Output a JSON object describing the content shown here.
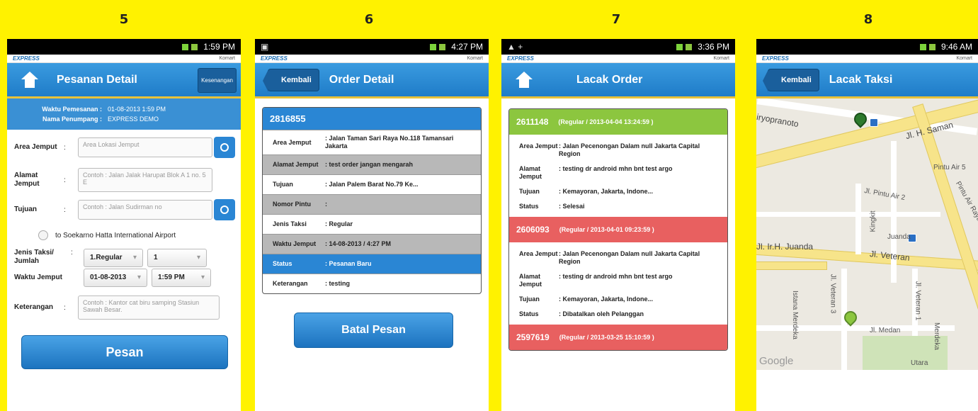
{
  "numbers": [
    "5",
    "6",
    "7",
    "8"
  ],
  "common": {
    "brand_left": "EXPRESS",
    "brand_right": "Komart"
  },
  "phone5": {
    "time": "1:59 PM",
    "header_title": "Pesanan Detail",
    "header_button": "Kesenangan",
    "info": [
      {
        "label": "Waktu Pemesanan :",
        "value": "01-08-2013 1:59 PM"
      },
      {
        "label": "Nama Penumpang :",
        "value": "EXPRESS DEMO"
      }
    ],
    "area_jemput": {
      "label": "Area Jemput",
      "placeholder": "Area Lokasi Jemput"
    },
    "alamat_jemput": {
      "label": "Alamat Jemput",
      "placeholder": "Contoh : Jalan Jalak Harupat Blok A 1 no. 5 E"
    },
    "tujuan": {
      "label": "Tujuan",
      "placeholder": "Contoh : Jalan Sudirman no"
    },
    "airport": "to Soekarno Hatta International Airport",
    "jenis": {
      "label": "Jenis Taksi/ Jumlah",
      "value": "1.Regular",
      "count": "1"
    },
    "waktu": {
      "label": "Waktu Jemput",
      "date": "01-08-2013",
      "time": "1:59 PM"
    },
    "keterangan": {
      "label": "Keterangan",
      "placeholder": "Contoh : Kantor cat biru samping Stasiun Sawah Besar."
    },
    "submit": "Pesan"
  },
  "phone6": {
    "time": "4:27 PM",
    "back": "Kembali",
    "header_title": "Order Detail",
    "order_id": "2816855",
    "rows": [
      {
        "k": "Area Jemput",
        "v": ": Jalan Taman Sari Raya No.118 Tamansari Jakarta",
        "style": "white"
      },
      {
        "k": "Alamat Jemput",
        "v": ": test order jangan mengarah",
        "style": "gray"
      },
      {
        "k": "Tujuan",
        "v": ": Jalan Palem Barat No.79 Ke...",
        "style": "white"
      },
      {
        "k": "Nomor Pintu",
        "v": ":",
        "style": "gray"
      },
      {
        "k": "Jenis Taksi",
        "v": ": Regular",
        "style": "white"
      },
      {
        "k": "Waktu Jemput",
        "v": ": 14-08-2013 / 4:27 PM",
        "style": "gray"
      },
      {
        "k": "Status",
        "v": ": Pesanan Baru",
        "style": "blue"
      },
      {
        "k": "Keterangan",
        "v": ": testing",
        "style": "white"
      }
    ],
    "cancel": "Batal Pesan"
  },
  "phone7": {
    "time": "3:36 PM",
    "header_title": "Lacak Order",
    "orders": [
      {
        "id": "2611148",
        "meta": "(Regular / 2013-04-04 13:24:59 )",
        "color": "green",
        "rows": [
          {
            "k": "Area Jemput",
            "v": ": Jalan Pecenongan Dalam null Jakarta Capital Region"
          },
          {
            "k": "Alamat Jemput",
            "v": ": testing dr android mhn bnt test argo"
          },
          {
            "k": "Tujuan",
            "v": ": Kemayoran, Jakarta, Indone..."
          },
          {
            "k": "Status",
            "v": ": Selesai"
          }
        ]
      },
      {
        "id": "2606093",
        "meta": "(Regular / 2013-04-01 09:23:59 )",
        "color": "red",
        "rows": [
          {
            "k": "Area Jemput",
            "v": ": Jalan Pecenongan Dalam null Jakarta Capital Region"
          },
          {
            "k": "Alamat Jemput",
            "v": ": testing dr android mhn bnt test argo"
          },
          {
            "k": "Tujuan",
            "v": ": Kemayoran, Jakarta, Indone..."
          },
          {
            "k": "Status",
            "v": ": Dibatalkan oleh Pelanggan"
          }
        ]
      },
      {
        "id": "2597619",
        "meta": "(Regular / 2013-03-25 15:10:59 )",
        "color": "red",
        "rows": []
      }
    ]
  },
  "phone8": {
    "time": "9:46 AM",
    "back": "Kembali",
    "header_title": "Lacak Taksi",
    "map_labels": [
      "iryopranoto",
      "Jl. H. Saman",
      "Pintu Air 5",
      "Jl. Pintu Air 2",
      "Kingkit",
      "Juanda",
      "Pintu Air Raya",
      "Jl. Ir.H. Juanda",
      "Jl. Veteran",
      "Jl. Veteran 3",
      "Jl. Veteran 1",
      "Istana Merdeka",
      "Jl. Medan",
      "Merdeka",
      "Utara",
      "Google"
    ]
  }
}
